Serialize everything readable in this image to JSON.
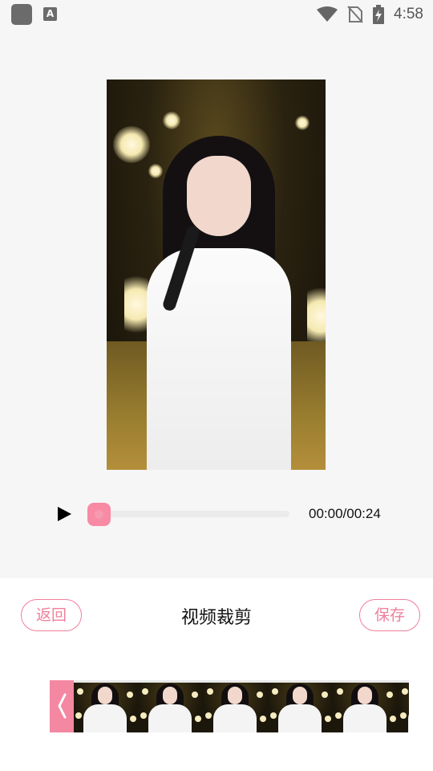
{
  "status_bar": {
    "time": "4:58",
    "icons": [
      "app-square-icon",
      "a-keyboard-icon",
      "wifi-icon",
      "no-sim-icon",
      "battery-charging-icon"
    ]
  },
  "player": {
    "time_display": "00:00/00:24",
    "progress": 0,
    "play_icon": "play-icon"
  },
  "toolbar": {
    "back_label": "返回",
    "title": "视频裁剪",
    "save_label": "保存"
  },
  "trim": {
    "handle_icon": "left-bracket-icon",
    "frame_count": 6
  },
  "colors": {
    "accent": "#f07f9c",
    "background": "#f6f6f6",
    "panel": "#ffffff"
  }
}
